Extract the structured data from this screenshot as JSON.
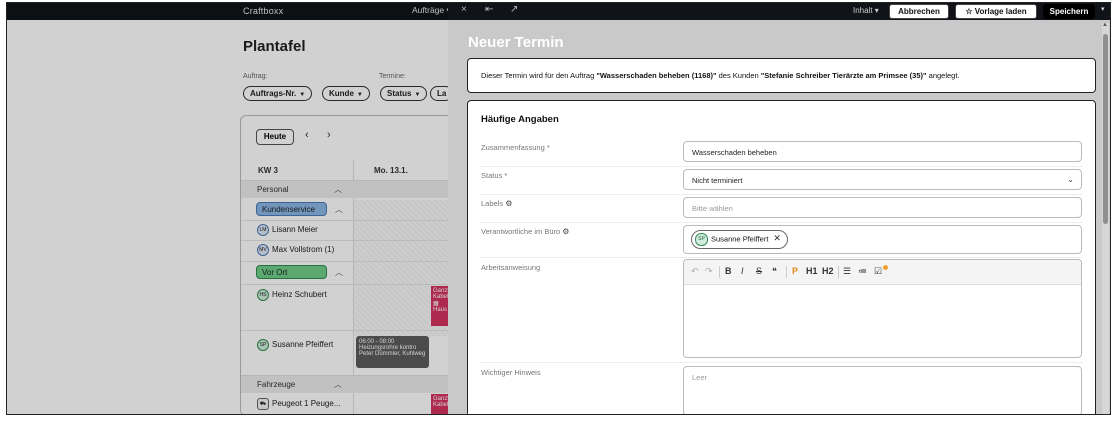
{
  "app": {
    "brand": "Craftboxx",
    "nav_auftraege": "Aufträge ▾"
  },
  "background": {
    "page_title": "Plantafel",
    "filters": {
      "auftrag_label": "Auftrag:",
      "termine_label": "Termine:",
      "pills": [
        "Auftrags-Nr.",
        "Kunde",
        "Status",
        "La"
      ]
    },
    "planner": {
      "today_button": "Heute",
      "prev": "‹",
      "next": "›",
      "week_label": "KW 3",
      "day_label": "Mo. 13.1.",
      "groups": {
        "personal": "Personal",
        "fahrzeuge": "Fahrzeuge"
      },
      "teams": {
        "kundenservice": "Kundenservice",
        "vor_ort": "Vor Ort"
      },
      "people": [
        {
          "initials": "LM",
          "name": "Lisann Meier"
        },
        {
          "initials": "MV",
          "name": "Max Vollstrom (1)"
        },
        {
          "initials": "HS",
          "name": "Heinz Schubert"
        },
        {
          "initials": "SP",
          "name": "Susanne Pfeiffert"
        }
      ],
      "vehicle": "Peugeot 1 Peuge...",
      "grey_event": {
        "time": "06:00 - 08:00",
        "title": "Heizungsrohre kontro",
        "sub": "Peter Dümmler, Kuhlweg"
      },
      "red_event_1": {
        "line1": "Ganzt",
        "line2": "Kabel ",
        "line3": "Haus Z"
      },
      "red_event_2": {
        "line1": "Ganzt",
        "line2": "Kabel "
      }
    }
  },
  "panel": {
    "toolbar": {
      "close": "×",
      "collapse": "⇤",
      "open_external": "↗",
      "inhalt": "Inhalt ▾",
      "abbrechen": "Abbrechen",
      "vorlage_laden": "☆ Vorlage laden",
      "speichern": "Speichern",
      "more": "▾"
    },
    "title": "Neuer Termin",
    "info": {
      "prefix": "Dieser Termin wird für den Auftrag ",
      "auftrag": "\"Wasserschaden beheben (1168)\"",
      "middle": " des Kunden ",
      "kunde": "\"Stefanie Schreiber Tierärzte am Primsee (35)\"",
      "suffix": " angelegt."
    },
    "form": {
      "section_title": "Häufige Angaben",
      "zusammenfassung_label": "Zusammenfassung *",
      "zusammenfassung_value": "Wasserschaden beheben",
      "status_label": "Status *",
      "status_value": "Nicht terminiert",
      "labels_label": "Labels",
      "labels_placeholder": "Bitte wählen",
      "verantwortliche_label": "Verantwortliche im Büro",
      "verantwortliche_chip": {
        "initials": "SP",
        "name": "Susanne Pfeiffert"
      },
      "arbeitsanweisung_label": "Arbeitsanweisung",
      "wichtiger_hinweis_label": "Wichtiger Hinweis",
      "wichtiger_hinweis_placeholder": "Leer"
    },
    "editor_toolbar": [
      "↶",
      "↷",
      "B",
      "I",
      "S",
      "❝",
      "P",
      "H1",
      "H2",
      "☰",
      "≔",
      "☑"
    ]
  },
  "colors": {
    "accent_orange": "#e58a1f",
    "team_blue": "#8cb6e6",
    "team_green": "#6fcf8a",
    "event_red": "#d4335f"
  }
}
